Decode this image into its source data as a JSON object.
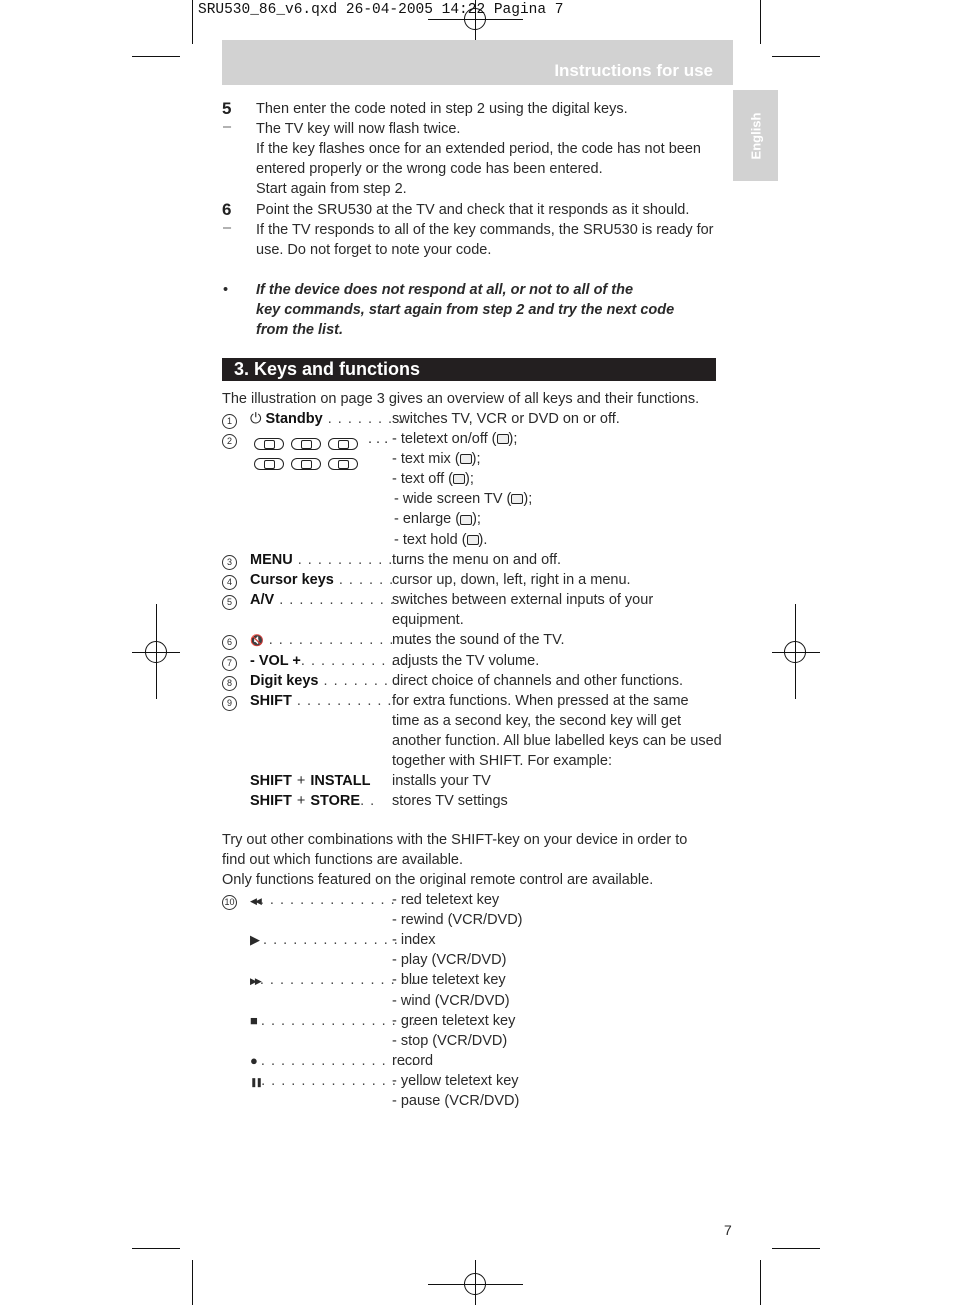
{
  "slug": "SRU530_86_v6.qxd 26-04-2005 14:22 Pagina 7",
  "header": {
    "title": "Instructions for use"
  },
  "language_tab": "English",
  "steps": [
    {
      "marker": "5",
      "text": "Then enter the code noted in step 2 using the digital keys."
    },
    {
      "marker": "–",
      "text": "The TV key will now flash twice."
    },
    {
      "marker": "",
      "text": "If the key flashes once for an extended period, the code has not been"
    },
    {
      "marker": "",
      "text": "entered properly or the wrong code has been entered."
    },
    {
      "marker": "",
      "text": "Start again from step 2."
    },
    {
      "marker": "6",
      "text": "Point the SRU530 at the TV and check that it responds as it should."
    },
    {
      "marker": "–",
      "text": "If the TV responds to all of the key commands, the SRU530 is ready for"
    },
    {
      "marker": "",
      "text": "use. Do not forget to note your code."
    }
  ],
  "note": {
    "bullet": "•",
    "lines": [
      "If the device does not respond at all, or not to all of the",
      "key commands, start again from step 2 and try the next code",
      "from the list."
    ]
  },
  "section": {
    "title": "3. Keys and functions"
  },
  "intro": "The illustration on page 3 gives an overview of all keys and their functions.",
  "keys": [
    {
      "n": "1",
      "icon": "standby-icon",
      "glyph": "⏻",
      "label": "Standby",
      "dots": " . . . . . . . .",
      "desc": [
        "switches TV, VCR or DVD on or off."
      ]
    },
    {
      "n": "3",
      "label": "MENU",
      "dots": " . . . . . . . . . . .",
      "desc": [
        "turns the menu on and off."
      ]
    },
    {
      "n": "4",
      "label": "Cursor keys",
      "dots": " . . . . . .",
      "desc": [
        "cursor up, down, left, right in a menu."
      ]
    },
    {
      "n": "5",
      "label": "A/V",
      "dots": " . . . . . . . . . . . . . .",
      "desc": [
        "switches between external inputs of your",
        "equipment."
      ]
    },
    {
      "n": "6",
      "glyph": "🔇",
      "label": "",
      "dots": " . . . . . . . . . . . . . . . .",
      "desc": [
        "mutes the sound of the TV."
      ]
    },
    {
      "n": "7",
      "label": "- VOL +",
      "dots": ". . . . . . . . . . .",
      "desc": [
        "adjusts the TV volume."
      ]
    },
    {
      "n": "8",
      "label": "Digit keys",
      "dots": " . . . . . . . .",
      "desc": [
        "direct choice of channels and other functions."
      ]
    },
    {
      "n": "9",
      "label": "SHIFT",
      "dots": " . . . . . . . . . . .",
      "desc": [
        "for extra functions. When pressed at the same",
        "time as a second key, the second key will get",
        "another function. All blue labelled keys can be used",
        "together with SHIFT. For example:"
      ]
    }
  ],
  "teletext": {
    "n": "2",
    "dots": ". . .",
    "items": [
      "- teletext on/off (",
      "- text mix (",
      "- text off (",
      "- wide screen TV (",
      "- enlarge (",
      "- text hold ("
    ],
    "ends": [
      ");",
      ");",
      ");",
      ");",
      ");",
      ")."
    ]
  },
  "shift_combos": [
    {
      "a": "SHIFT",
      "plus": "+",
      "b": "INSTALL",
      "dots": "",
      "desc": "installs your TV"
    },
    {
      "a": "SHIFT",
      "plus": "+",
      "b": "STORE",
      "dots": ". .",
      "desc": "stores TV settings"
    }
  ],
  "try_text": [
    "Try out other combinations with the SHIFT-key on your device in order to",
    "find out which functions are available.",
    "Only functions featured on the original remote control are available."
  ],
  "transport": {
    "n": "10",
    "items": [
      {
        "icon": "rewind-icon",
        "glyph": "◀◀",
        "dots": ". . . . . . . . . . . . . . . .",
        "desc": [
          "- red teletext key",
          "- rewind (VCR/DVD)"
        ]
      },
      {
        "icon": "play-icon",
        "glyph": "▶",
        "dots": " . . . . . . . . . . . . . . . .",
        "desc": [
          "- index",
          "- play (VCR/DVD)"
        ]
      },
      {
        "icon": "fast-forward-icon",
        "glyph": "▶▶",
        "dots": ". . . . . . . . . . . . . . . .",
        "desc": [
          "- blue teletext key",
          "- wind (VCR/DVD)"
        ]
      },
      {
        "icon": "stop-icon",
        "glyph": "■",
        "dots": " . . . . . . . . . . . . . . . .",
        "desc": [
          "- green teletext key",
          "- stop (VCR/DVD)"
        ]
      },
      {
        "icon": "record-icon",
        "glyph": "●",
        "dots": " . . . . . . . . . . . . . . . .",
        "desc": [
          "record"
        ]
      },
      {
        "icon": "pause-icon",
        "glyph": "❚❚",
        "dots": ". . . . . . . . . . . . . . . . .",
        "desc": [
          "- yellow teletext key",
          "- pause (VCR/DVD)"
        ]
      }
    ]
  },
  "page_number": "7"
}
